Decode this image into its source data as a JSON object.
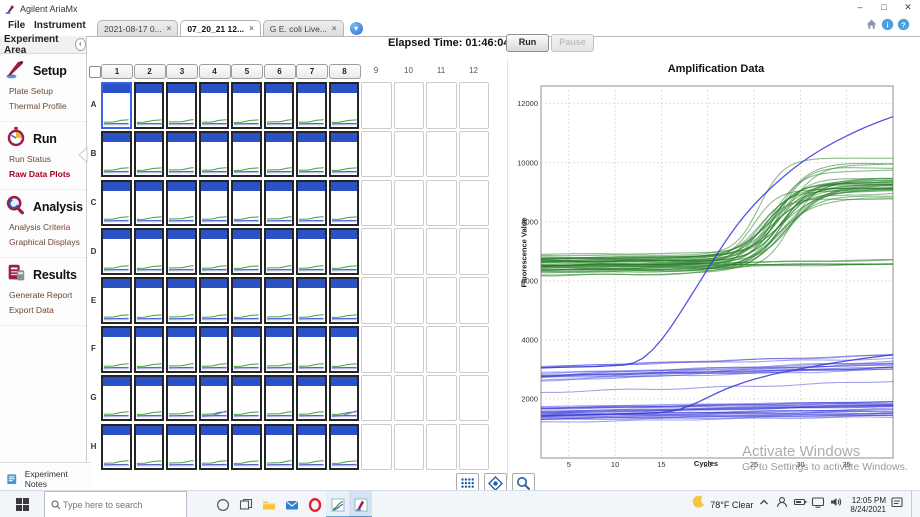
{
  "window": {
    "title": "Agilent AriaMx"
  },
  "titlebar_controls": [
    "minimize",
    "maximize",
    "close"
  ],
  "menu": {
    "items": [
      "File",
      "Instrument"
    ]
  },
  "tabs": {
    "items": [
      {
        "label": "2021-08-17 0...",
        "active": false
      },
      {
        "label": "07_20_21 12...",
        "active": true
      },
      {
        "label": "G E. coli Live...",
        "active": false
      }
    ]
  },
  "header_icons": [
    "home-icon",
    "info-icon",
    "help-icon"
  ],
  "sidebar": {
    "header": "Experiment Area",
    "sections": [
      {
        "title": "Setup",
        "icon": "setup-pen-icon",
        "items": [
          {
            "label": "Plate Setup",
            "selected": false
          },
          {
            "label": "Thermal Profile",
            "selected": false
          }
        ]
      },
      {
        "title": "Run",
        "icon": "run-stopwatch-icon",
        "items": [
          {
            "label": "Run Status",
            "selected": false
          },
          {
            "label": "Raw Data Plots",
            "selected": true
          }
        ]
      },
      {
        "title": "Analysis",
        "icon": "analysis-magnifier-icon",
        "items": [
          {
            "label": "Analysis Criteria",
            "selected": false
          },
          {
            "label": "Graphical Displays",
            "selected": false
          }
        ]
      },
      {
        "title": "Results",
        "icon": "results-report-icon",
        "items": [
          {
            "label": "Generate Report",
            "selected": false
          },
          {
            "label": "Export Data",
            "selected": false
          }
        ]
      }
    ],
    "footer": {
      "label": "Experiment Notes",
      "icon": "notes-icon"
    }
  },
  "runbar": {
    "elapsed": "Elapsed Time: 01:46:04",
    "run": "Run",
    "pause": "Pause",
    "pause_enabled": false
  },
  "plate": {
    "columns": [
      "1",
      "2",
      "3",
      "4",
      "5",
      "6",
      "7",
      "8",
      "9",
      "10",
      "11",
      "12"
    ],
    "rows": [
      "A",
      "B",
      "C",
      "D",
      "E",
      "F",
      "G",
      "H"
    ],
    "filled_columns": 8,
    "selected_well": "A1",
    "well_bar_color": "#2b51c7",
    "riser_wells": [
      "G4",
      "G8"
    ]
  },
  "plate_toolbar": [
    "well-selector-grid-icon",
    "fit-view-icon",
    "zoom-icon"
  ],
  "chart_data": {
    "type": "line",
    "title": "Amplification Data",
    "xlabel": "Cycles",
    "ylabel": "Fluorescence Value",
    "xlim": [
      2,
      40
    ],
    "ylim": [
      0,
      12600
    ],
    "xticks": [
      5,
      10,
      15,
      20,
      25,
      30,
      35
    ],
    "yticks": [
      2000,
      4000,
      6000,
      8000,
      10000,
      12000
    ],
    "grid": true,
    "legend": false,
    "colors": {
      "green": "#1e7a1e",
      "blue": "#3636d8"
    },
    "series": [
      {
        "name": "blue-steep-sigmoid-outlier",
        "color": "blue",
        "points": [
          [
            2,
            3050
          ],
          [
            4,
            3070
          ],
          [
            8,
            3100
          ],
          [
            11,
            3150
          ],
          [
            12,
            3220
          ],
          [
            13,
            3380
          ],
          [
            14,
            3650
          ],
          [
            15,
            4000
          ],
          [
            16,
            4430
          ],
          [
            17,
            4900
          ],
          [
            18,
            5400
          ],
          [
            19,
            5900
          ],
          [
            20,
            6400
          ],
          [
            21,
            6900
          ],
          [
            22,
            7380
          ],
          [
            23,
            7820
          ],
          [
            24,
            8220
          ],
          [
            25,
            8580
          ],
          [
            26,
            8900
          ],
          [
            27,
            9200
          ],
          [
            28,
            9480
          ],
          [
            29,
            9740
          ],
          [
            30,
            9980
          ],
          [
            31,
            10200
          ],
          [
            32,
            10400
          ],
          [
            33,
            10580
          ],
          [
            34,
            10750
          ],
          [
            35,
            10910
          ],
          [
            36,
            11060
          ],
          [
            37,
            11200
          ],
          [
            38,
            11330
          ],
          [
            39,
            11450
          ],
          [
            40,
            11560
          ]
        ]
      },
      {
        "name": "blue-late-riser",
        "color": "blue",
        "points": [
          [
            2,
            1430
          ],
          [
            6,
            1460
          ],
          [
            10,
            1490
          ],
          [
            13,
            1510
          ],
          [
            15,
            1540
          ],
          [
            16,
            1580
          ],
          [
            17,
            1650
          ],
          [
            18,
            1760
          ],
          [
            19,
            1900
          ],
          [
            20,
            2050
          ],
          [
            21,
            2200
          ],
          [
            22,
            2340
          ],
          [
            23,
            2460
          ],
          [
            24,
            2570
          ],
          [
            25,
            2670
          ],
          [
            27,
            2830
          ],
          [
            29,
            2960
          ],
          [
            31,
            3080
          ],
          [
            33,
            3190
          ],
          [
            35,
            3290
          ],
          [
            37,
            3380
          ],
          [
            40,
            3500
          ]
        ]
      }
    ],
    "bundles": [
      {
        "name": "green-amplified-wells",
        "color": "green",
        "count": 32,
        "start": [
          6200,
          6900
        ],
        "drift": [
          0,
          120
        ],
        "sig_amp": [
          2300,
          3300
        ],
        "ct": [
          25,
          29
        ],
        "k": [
          1.2,
          2.2
        ],
        "wiggle": [
          8,
          28
        ],
        "width": 1.1,
        "opacity": 0.5
      },
      {
        "name": "green-flat-baselines",
        "color": "green",
        "count": 6,
        "start": [
          6280,
          6700
        ],
        "drift": [
          40,
          200
        ],
        "sig_amp": [
          0,
          0
        ],
        "ct": [
          60,
          61
        ],
        "k": [
          2,
          3
        ],
        "wiggle": [
          6,
          16
        ],
        "width": 1.1,
        "opacity": 0.5
      },
      {
        "name": "blue-low-baseline-band",
        "color": "blue",
        "count": 24,
        "start": [
          1200,
          1750
        ],
        "drift": [
          40,
          260
        ],
        "sig_amp": [
          0,
          0
        ],
        "ct": [
          60,
          61
        ],
        "k": [
          2,
          3
        ],
        "wiggle": [
          4,
          18
        ],
        "width": 1.1,
        "opacity": 0.45
      },
      {
        "name": "blue-mid-baseline-band",
        "color": "blue",
        "count": 15,
        "start": [
          2150,
          3120
        ],
        "drift": [
          240,
          460
        ],
        "sig_amp": [
          0,
          0
        ],
        "ct": [
          60,
          61
        ],
        "k": [
          2,
          3
        ],
        "wiggle": [
          8,
          26
        ],
        "width": 1.1,
        "opacity": 0.45
      }
    ]
  },
  "watermark": {
    "line1": "Activate Windows",
    "line2": "Go to Settings to activate Windows."
  },
  "taskbar": {
    "search_placeholder": "Type here to search",
    "left_icons": [
      "cortana-icon",
      "task-view-icon",
      "file-explorer-icon",
      "mail-icon",
      "opera-icon",
      "aria-chart-running-icon",
      "aria-app-active-icon"
    ],
    "weather": {
      "temp": "78°F",
      "condition": "Clear"
    },
    "tray_icons": [
      "hidden-icons-chevron",
      "people-icon",
      "battery-icon",
      "display-icon",
      "volume-icon"
    ],
    "time": "12:05 PM",
    "date": "8/24/2021"
  }
}
